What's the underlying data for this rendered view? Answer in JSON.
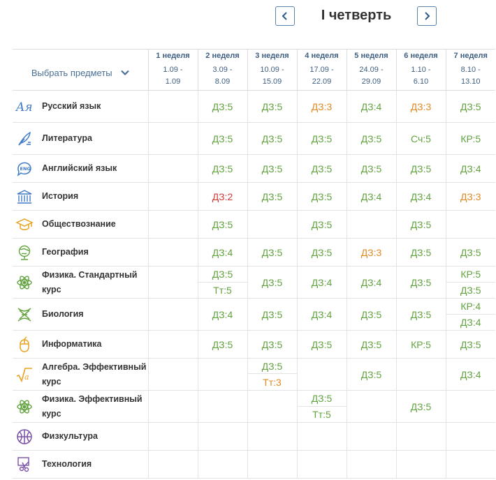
{
  "header": {
    "quarter_title": "I четверть",
    "prev_icon": "chevron-left-icon",
    "next_icon": "chevron-right-icon"
  },
  "subject_picker": {
    "label": "Выбрать предметы",
    "icon": "chevron-down-icon"
  },
  "weeks": [
    {
      "label": "1 неделя",
      "from": "1.09 -",
      "to": "1.09"
    },
    {
      "label": "2 неделя",
      "from": "3.09 -",
      "to": "8.09"
    },
    {
      "label": "3 неделя",
      "from": "10.09 -",
      "to": "15.09"
    },
    {
      "label": "4 неделя",
      "from": "17.09 -",
      "to": "22.09"
    },
    {
      "label": "5 неделя",
      "from": "24.09 -",
      "to": "29.09"
    },
    {
      "label": "6 неделя",
      "from": "1.10 -",
      "to": "6.10"
    },
    {
      "label": "7 неделя",
      "from": "8.10 -",
      "to": "13.10"
    }
  ],
  "colors": {
    "good": "#62a33f",
    "average": "#e08a24",
    "bad": "#d23a3a",
    "accent": "#3f5f82",
    "border": "#e3e3e3"
  },
  "subjects": [
    {
      "name": "Русский язык",
      "icon": "russian-language-icon",
      "grades": [
        [],
        [
          {
            "text": "ДЗ:5",
            "level": "good"
          }
        ],
        [
          {
            "text": "ДЗ:5",
            "level": "good"
          }
        ],
        [
          {
            "text": "ДЗ:3",
            "level": "average"
          }
        ],
        [
          {
            "text": "ДЗ:4",
            "level": "good"
          }
        ],
        [
          {
            "text": "ДЗ:3",
            "level": "average"
          }
        ],
        [
          {
            "text": "ДЗ:5",
            "level": "good"
          }
        ]
      ]
    },
    {
      "name": "Литература",
      "icon": "quill-icon",
      "grades": [
        [],
        [
          {
            "text": "ДЗ:5",
            "level": "good"
          }
        ],
        [
          {
            "text": "ДЗ:5",
            "level": "good"
          }
        ],
        [
          {
            "text": "ДЗ:5",
            "level": "good"
          }
        ],
        [
          {
            "text": "ДЗ:5",
            "level": "good"
          }
        ],
        [
          {
            "text": "Сч:5",
            "level": "good"
          }
        ],
        [
          {
            "text": "КР:5",
            "level": "good"
          }
        ]
      ]
    },
    {
      "name": "Английский язык",
      "icon": "eng-bubble-icon",
      "grades": [
        [],
        [
          {
            "text": "ДЗ:5",
            "level": "good"
          }
        ],
        [
          {
            "text": "ДЗ:5",
            "level": "good"
          }
        ],
        [
          {
            "text": "ДЗ:5",
            "level": "good"
          }
        ],
        [
          {
            "text": "ДЗ:5",
            "level": "good"
          }
        ],
        [
          {
            "text": "ДЗ:5",
            "level": "good"
          }
        ],
        [
          {
            "text": "ДЗ:4",
            "level": "good"
          }
        ]
      ]
    },
    {
      "name": "История",
      "icon": "museum-icon",
      "grades": [
        [],
        [
          {
            "text": "ДЗ:2",
            "level": "bad"
          }
        ],
        [
          {
            "text": "ДЗ:5",
            "level": "good"
          }
        ],
        [
          {
            "text": "ДЗ:5",
            "level": "good"
          }
        ],
        [
          {
            "text": "ДЗ:4",
            "level": "good"
          }
        ],
        [
          {
            "text": "ДЗ:4",
            "level": "good"
          }
        ],
        [
          {
            "text": "ДЗ:3",
            "level": "average"
          }
        ]
      ]
    },
    {
      "name": "Обществознание",
      "icon": "graduation-cap-icon",
      "grades": [
        [],
        [
          {
            "text": "ДЗ:5",
            "level": "good"
          }
        ],
        [],
        [
          {
            "text": "ДЗ:5",
            "level": "good"
          }
        ],
        [],
        [
          {
            "text": "ДЗ:5",
            "level": "good"
          }
        ],
        []
      ]
    },
    {
      "name": "География",
      "icon": "globe-icon",
      "grades": [
        [],
        [
          {
            "text": "ДЗ:4",
            "level": "good"
          }
        ],
        [
          {
            "text": "ДЗ:5",
            "level": "good"
          }
        ],
        [
          {
            "text": "ДЗ:5",
            "level": "good"
          }
        ],
        [
          {
            "text": "ДЗ:3",
            "level": "average"
          }
        ],
        [
          {
            "text": "ДЗ:5",
            "level": "good"
          }
        ],
        [
          {
            "text": "ДЗ:5",
            "level": "good"
          }
        ]
      ]
    },
    {
      "name": "Физика. Стандартный курс",
      "icon": "atom-icon",
      "grades": [
        [],
        [
          {
            "text": "ДЗ:5",
            "level": "good"
          },
          {
            "text": "Тт:5",
            "level": "good"
          }
        ],
        [
          {
            "text": "ДЗ:5",
            "level": "good"
          }
        ],
        [
          {
            "text": "ДЗ:4",
            "level": "good"
          }
        ],
        [
          {
            "text": "ДЗ:4",
            "level": "good"
          }
        ],
        [
          {
            "text": "ДЗ:5",
            "level": "good"
          }
        ],
        [
          {
            "text": "КР:5",
            "level": "good"
          },
          {
            "text": "ДЗ:5",
            "level": "good"
          }
        ]
      ]
    },
    {
      "name": "Биология",
      "icon": "dna-icon",
      "grades": [
        [],
        [
          {
            "text": "ДЗ:4",
            "level": "good"
          }
        ],
        [
          {
            "text": "ДЗ:5",
            "level": "good"
          }
        ],
        [
          {
            "text": "ДЗ:4",
            "level": "good"
          }
        ],
        [
          {
            "text": "ДЗ:5",
            "level": "good"
          }
        ],
        [
          {
            "text": "ДЗ:5",
            "level": "good"
          }
        ],
        [
          {
            "text": "КР:4",
            "level": "good"
          },
          {
            "text": "ДЗ:4",
            "level": "good"
          }
        ]
      ]
    },
    {
      "name": "Информатика",
      "icon": "mouse-icon",
      "grades": [
        [],
        [
          {
            "text": "ДЗ:5",
            "level": "good"
          }
        ],
        [
          {
            "text": "ДЗ:5",
            "level": "good"
          }
        ],
        [
          {
            "text": "ДЗ:5",
            "level": "good"
          }
        ],
        [
          {
            "text": "ДЗ:5",
            "level": "good"
          }
        ],
        [
          {
            "text": "КР:5",
            "level": "good"
          }
        ],
        [
          {
            "text": "ДЗ:5",
            "level": "good"
          }
        ]
      ]
    },
    {
      "name": "Алгебра. Эффективный курс",
      "icon": "square-root-icon",
      "grades": [
        [],
        [],
        [
          {
            "text": "ДЗ:5",
            "level": "good"
          },
          {
            "text": "Тт:3",
            "level": "average"
          }
        ],
        [],
        [
          {
            "text": "ДЗ:5",
            "level": "good"
          }
        ],
        [],
        [
          {
            "text": "ДЗ:4",
            "level": "good"
          }
        ]
      ]
    },
    {
      "name": "Физика. Эффективный курс",
      "icon": "atom-icon",
      "grades": [
        [],
        [],
        [],
        [
          {
            "text": "ДЗ:5",
            "level": "good"
          },
          {
            "text": "Тт:5",
            "level": "good"
          }
        ],
        [],
        [
          {
            "text": "ДЗ:5",
            "level": "good"
          }
        ],
        []
      ]
    },
    {
      "name": "Физкультура",
      "icon": "basketball-icon",
      "grades": [
        [],
        [],
        [],
        [],
        [],
        [],
        []
      ]
    },
    {
      "name": "Технология",
      "icon": "scissors-board-icon",
      "grades": [
        [],
        [],
        [],
        [],
        [],
        [],
        []
      ]
    }
  ]
}
